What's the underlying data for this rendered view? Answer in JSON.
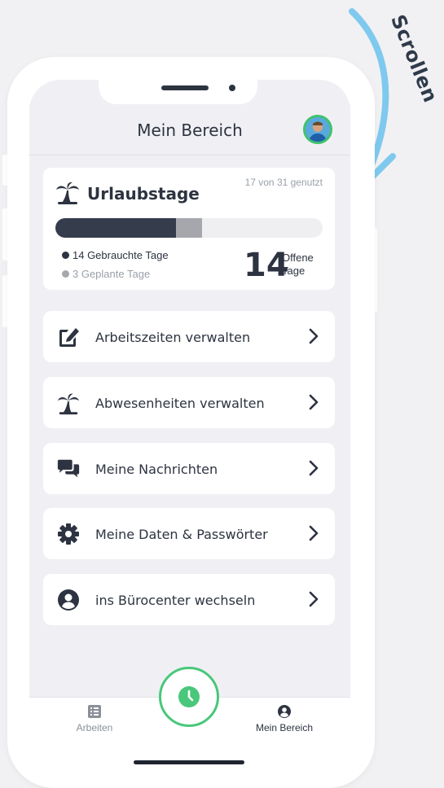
{
  "annotation": {
    "text": "Scrollen"
  },
  "header": {
    "title": "Mein Bereich",
    "avatar_icon": "avatar"
  },
  "vacation": {
    "title": "Urlaubstage",
    "used_of_total": "17 von 31 genutzt",
    "used_fraction": 0.4516,
    "planned_fraction": 0.0968,
    "legend_used": "14 Gebrauchte Tage",
    "legend_planned": "3 Geplante Tage",
    "open_number": "14",
    "open_label_line1": "Offene",
    "open_label_line2": "Tage",
    "colors": {
      "used": "#353d4c",
      "planned": "#a6a7ad",
      "track": "#efeff2"
    }
  },
  "menu": [
    {
      "label": "Arbeitszeiten verwalten",
      "icon": "edit-icon"
    },
    {
      "label": "Abwesenheiten verwalten",
      "icon": "palm-tree-icon"
    },
    {
      "label": "Meine Nachrichten",
      "icon": "chat-icon"
    },
    {
      "label": "Meine Daten & Passwörter",
      "icon": "gear-icon"
    },
    {
      "label": "ins Bürocenter wechseln",
      "icon": "user-circle-icon"
    }
  ],
  "tabbar": {
    "left_label": "Arbeiten",
    "right_label": "Mein Bereich",
    "center_icon": "clock-icon",
    "accent": "#49c77a"
  }
}
